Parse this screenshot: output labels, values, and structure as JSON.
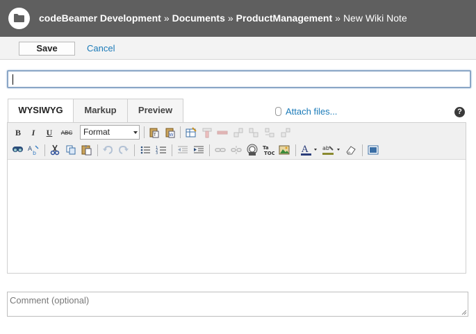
{
  "header": {
    "breadcrumb": {
      "project": "codeBeamer Development",
      "sep1": "»",
      "section": "Documents",
      "sep2": "»",
      "folder": "ProductManagement",
      "sep3": "»",
      "current": "New Wiki Note"
    },
    "icon": "folder-icon"
  },
  "actions": {
    "save_label": "Save",
    "cancel_label": "Cancel"
  },
  "title_input": {
    "value": ""
  },
  "tabs": [
    {
      "label": "WYSIWYG",
      "active": true
    },
    {
      "label": "Markup",
      "active": false
    },
    {
      "label": "Preview",
      "active": false
    }
  ],
  "attach_label": "Attach files...",
  "help_label": "?",
  "toolbar": {
    "bold": "B",
    "italic": "I",
    "underline": "U",
    "strike": "ABC",
    "format_value": "Format"
  },
  "comment": {
    "placeholder": "Comment (optional)"
  },
  "colors": {
    "header_bg": "#5f5f5f",
    "link": "#1a7ab8",
    "focus_border": "#8aa6c6"
  }
}
